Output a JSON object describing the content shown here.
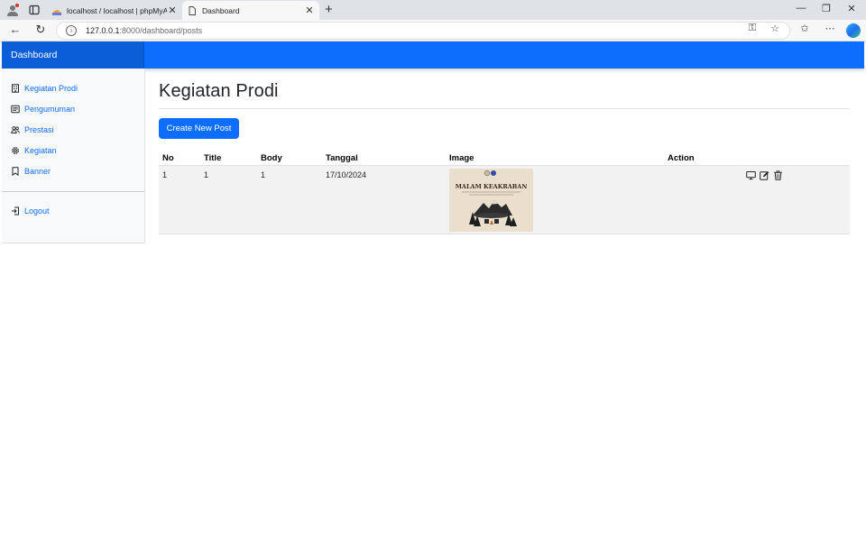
{
  "browser": {
    "tabs": [
      {
        "title": "localhost / localhost | phpMyAdm",
        "active": false
      },
      {
        "title": "Dashboard",
        "active": true
      }
    ],
    "url_host": "127.0.0.1",
    "url_path": ":8000/dashboard/posts"
  },
  "navbar": {
    "brand": "Dashboard"
  },
  "sidebar": {
    "items": [
      {
        "label": "Kegiatan Prodi",
        "icon": "building-icon"
      },
      {
        "label": "Pengumuman",
        "icon": "newspaper-icon"
      },
      {
        "label": "Prestasi",
        "icon": "people-icon"
      },
      {
        "label": "Kegiatan",
        "icon": "gear-icon"
      },
      {
        "label": "Banner",
        "icon": "bookmark-icon"
      }
    ],
    "logout": {
      "label": "Logout",
      "icon": "logout-icon"
    }
  },
  "main": {
    "title": "Kegiatan Prodi",
    "create_button": "Create New Post"
  },
  "table": {
    "headers": {
      "no": "No",
      "title": "Title",
      "body": "Body",
      "tanggal": "Tanggal",
      "image": "Image",
      "action": "Action"
    },
    "rows": [
      {
        "no": "1",
        "title": "1",
        "body": "1",
        "tanggal": "17/10/2024",
        "image_text": "MALAM KEAKRABAN"
      }
    ]
  },
  "colors": {
    "primary": "#0d6efd",
    "brand_bg": "#0b5ed7",
    "row_bg": "#f2f2f2"
  }
}
